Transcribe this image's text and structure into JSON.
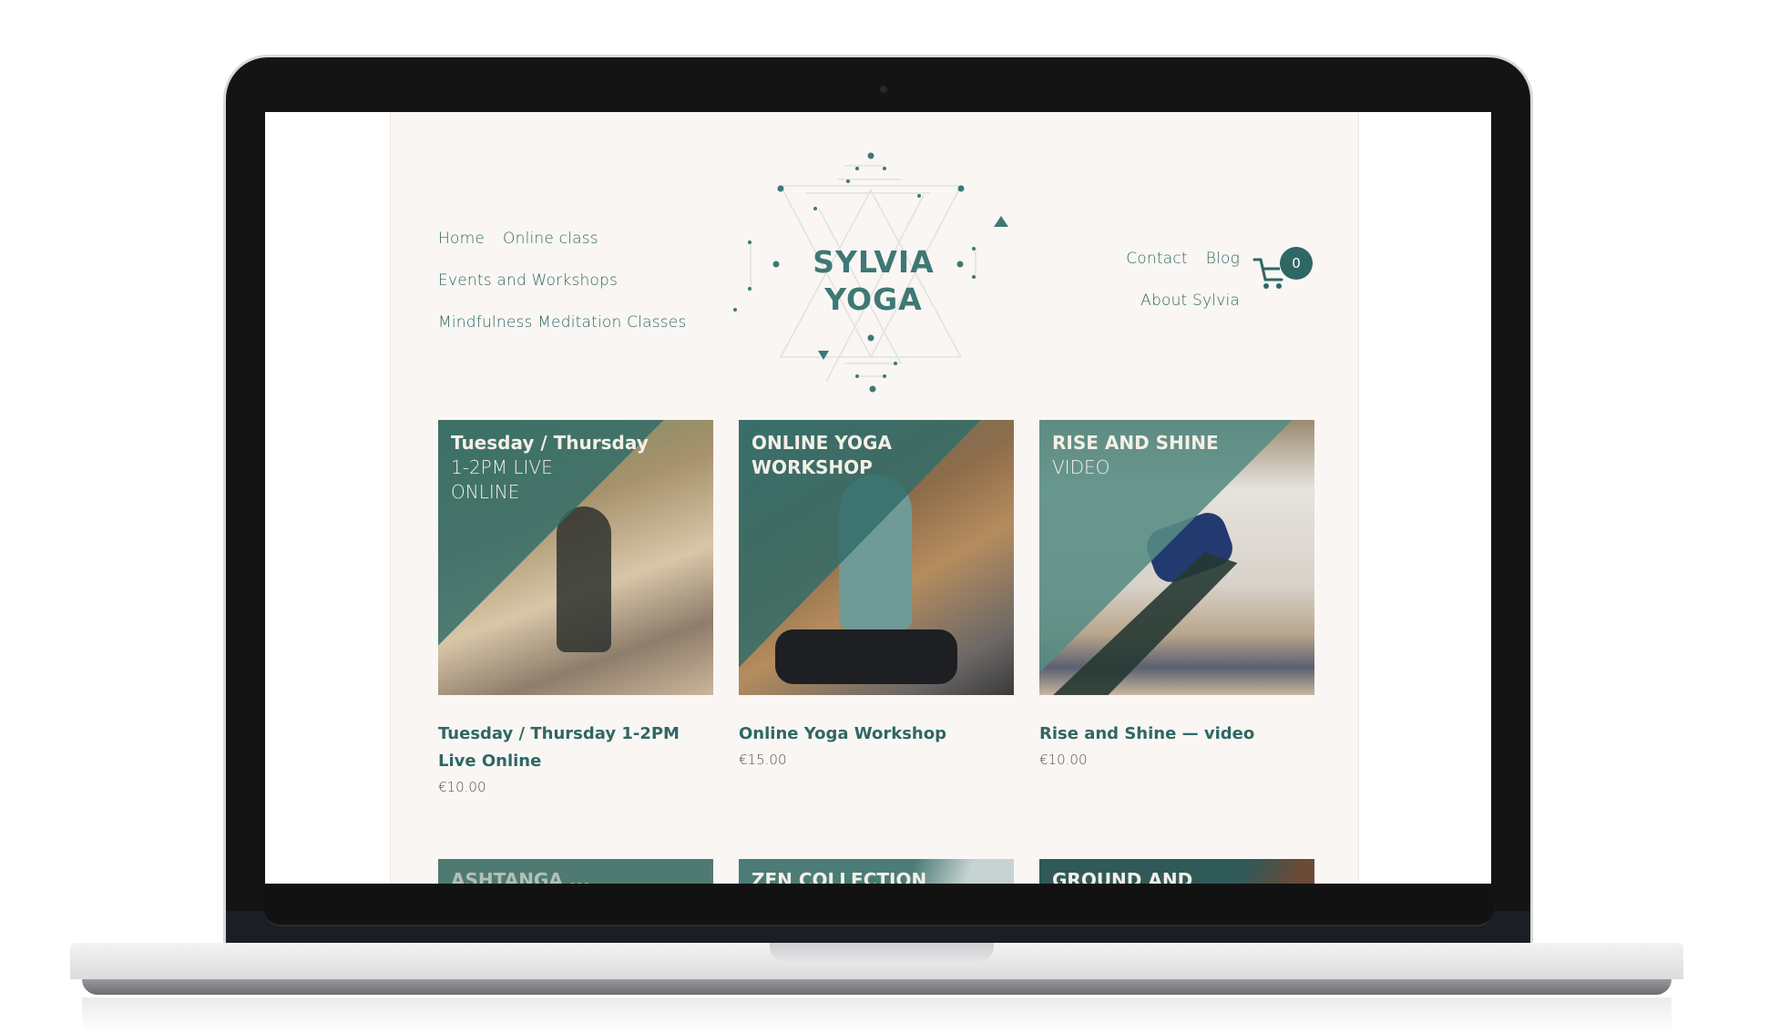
{
  "site": {
    "logo_line1": "SYLVIA",
    "logo_line2": "YOGA",
    "brand_color": "#2f6764",
    "background_color": "#f9f6f3"
  },
  "nav_left": [
    [
      "Home",
      "Online class"
    ],
    [
      "Events and Workshops"
    ],
    [
      "Mindfulness Meditation Classes"
    ]
  ],
  "nav_left_flat": {
    "home": "Home",
    "online_class": "Online class",
    "events": "Events and Workshops",
    "mindfulness": "Mindfulness Meditation Classes"
  },
  "nav_right": {
    "contact": "Contact",
    "blog": "Blog",
    "about": "About Sylvia"
  },
  "cart": {
    "icon": "shopping-cart-icon",
    "count": "0"
  },
  "products": [
    {
      "image_title_bold": "Tuesday / Thursday",
      "image_title_light1": "1-2PM LIVE",
      "image_title_light2": "ONLINE",
      "title": "Tuesday / Thursday 1-2PM Live Online",
      "price": "€10.00"
    },
    {
      "image_title_bold": "ONLINE YOGA",
      "image_title_bold2": "WORKSHOP",
      "title": "Online Yoga Workshop",
      "price": "€15.00"
    },
    {
      "image_title_bold": "RISE AND SHINE",
      "image_title_light1": "VIDEO",
      "title": "Rise and Shine — video",
      "price": "€10.00"
    }
  ],
  "products_row2": [
    {
      "image_title_bold": "ASHTANGA ..."
    },
    {
      "image_title_bold": "ZEN COLLECTION"
    },
    {
      "image_title_bold": "GROUND AND"
    }
  ]
}
